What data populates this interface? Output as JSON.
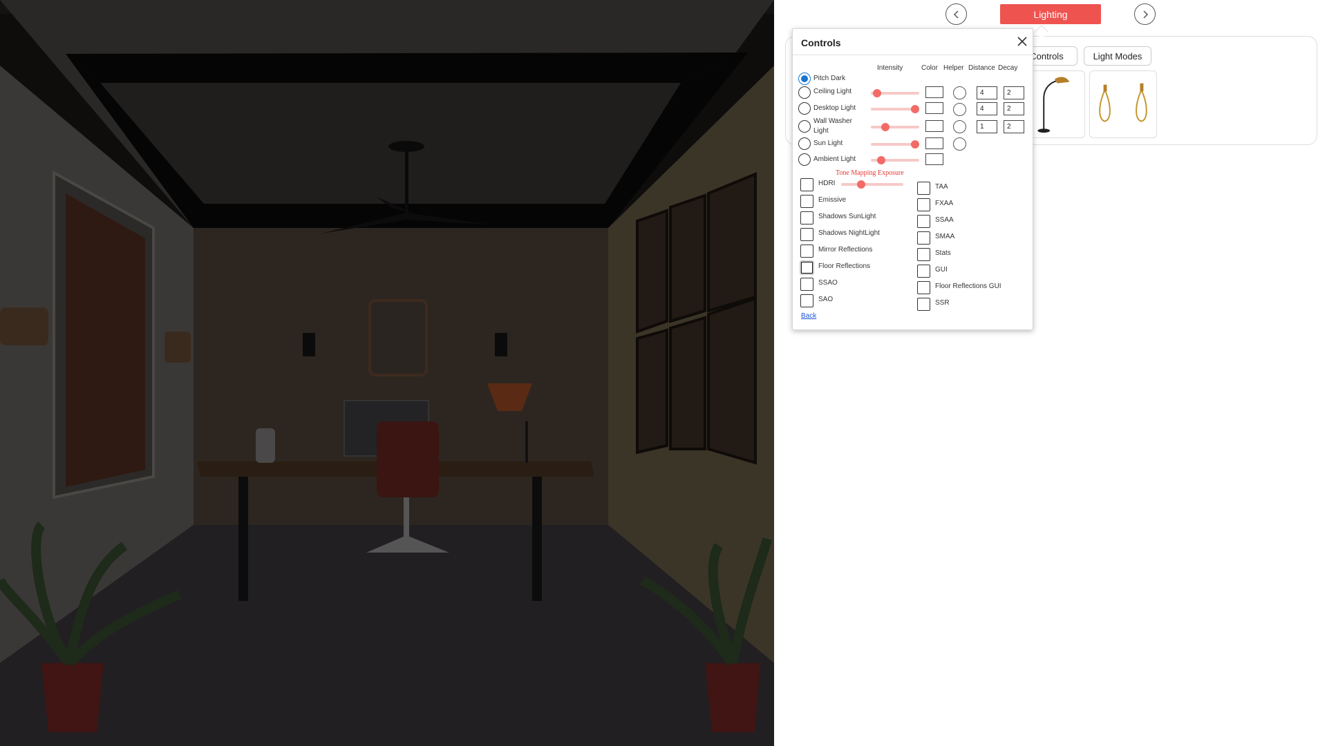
{
  "nav": {
    "prev_icon": "chevron-left-icon",
    "next_icon": "chevron-right-icon",
    "active_tab": "Lighting"
  },
  "toolbar": {
    "controls_label": "Controls",
    "light_modes_label": "Light Modes"
  },
  "thumbnails": [
    {
      "icon": "floor-lamp-icon"
    },
    {
      "icon": "pendant-lamps-icon"
    }
  ],
  "dialog": {
    "title": "Controls",
    "close_icon": "close-icon",
    "headers": {
      "intensity": "Intensity",
      "color": "Color",
      "helper": "Helper",
      "distance": "Distance",
      "decay": "Decay"
    },
    "lights": [
      {
        "label": "Pitch Dark",
        "selected": true
      },
      {
        "label": "Ceiling Light",
        "selected": false,
        "intensity": 0.05,
        "distance": "4",
        "decay": "2"
      },
      {
        "label": "Desktop Light",
        "selected": false,
        "intensity": 1.0,
        "distance": "4",
        "decay": "2"
      },
      {
        "label": "Wall Washer Light",
        "selected": false,
        "intensity": 0.25,
        "distance": "1",
        "decay": "2"
      },
      {
        "label": "Sun Light",
        "selected": false,
        "intensity": 1.0
      },
      {
        "label": "Ambient Light",
        "selected": false,
        "intensity": 0.15
      }
    ],
    "tone_mapping_label": "Tone Mapping Exposure",
    "tone_mapping_value": 0.3,
    "left_options": [
      {
        "label": "HDRI",
        "checked": false
      },
      {
        "label": "Emissive",
        "checked": false
      },
      {
        "label": "Shadows SunLight",
        "checked": false
      },
      {
        "label": "Shadows NightLight",
        "checked": false
      },
      {
        "label": "Mirror Reflections",
        "checked": false
      },
      {
        "label": "Floor Reflections",
        "checked": false,
        "focused": true
      },
      {
        "label": "SSAO",
        "checked": false
      },
      {
        "label": "SAO",
        "checked": false
      }
    ],
    "right_options": [
      {
        "label": "TAA",
        "checked": false
      },
      {
        "label": "FXAA",
        "checked": false
      },
      {
        "label": "SSAA",
        "checked": false
      },
      {
        "label": "SMAA",
        "checked": false
      },
      {
        "label": "Stats",
        "checked": false
      },
      {
        "label": "GUI",
        "checked": false
      },
      {
        "label": "Floor Reflections GUI",
        "checked": false
      },
      {
        "label": "SSR",
        "checked": false
      }
    ],
    "back_label": "Back"
  },
  "colors": {
    "accent": "#ef5350",
    "slider_track": "#f6c9c7",
    "slider_knob": "#f26b67",
    "radio_selected": "#1976d2",
    "link": "#1a55d6"
  }
}
